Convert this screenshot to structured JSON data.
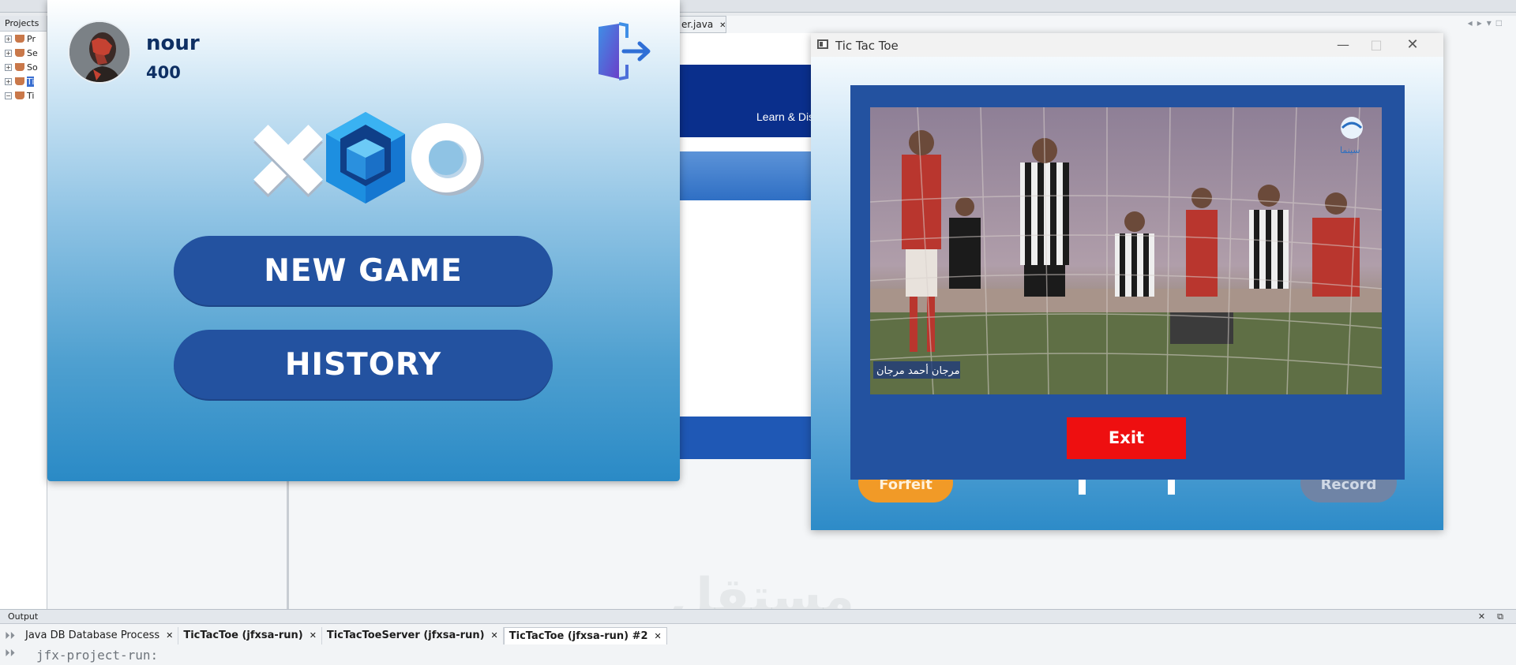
{
  "ide": {
    "projects_title": "Projects",
    "tree_items": [
      "Pr",
      "Se",
      "So",
      "Ti",
      "Ti"
    ],
    "editor_tab": "er.java",
    "output_title": "Output",
    "output_tabs": [
      "Java DB Database Process",
      "TicTacToe (jfxsa-run)",
      "TicTacToeServer (jfxsa-run)",
      "TicTacToe (jfxsa-run) #2"
    ],
    "console_line": "jfx-project-run:"
  },
  "bg_app": {
    "nav_text": "Learn & Dis"
  },
  "menu": {
    "username": "nour",
    "score": "400",
    "new_game_label": "NEW GAME",
    "history_label": "HISTORY"
  },
  "ttt": {
    "title": "Tic Tac Toe",
    "forfeit_label": "Forfeit",
    "record_label": "Record",
    "exit_label": "Exit",
    "video_caption": "مرجان أحمد مرجان",
    "channel_logo": "سينما"
  },
  "colors": {
    "button_blue": "#2352a0",
    "exit_red": "#ee0f10",
    "forfeit_orange": "#f19a27"
  },
  "watermark": "مستقل"
}
